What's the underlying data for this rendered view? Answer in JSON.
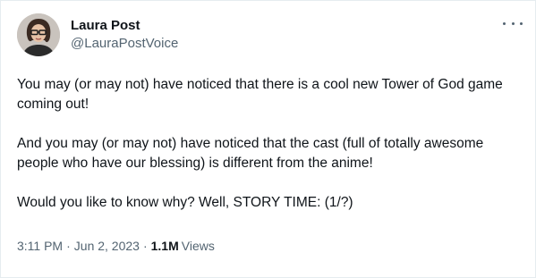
{
  "author": {
    "display_name": "Laura Post",
    "handle": "@LauraPostVoice",
    "avatar_icon": "profile-photo"
  },
  "menu": {
    "icon": "more-options-icon"
  },
  "tweet": {
    "paragraphs": [
      "You may (or may not) have noticed that there is a cool new Tower of God game coming out!",
      "And you may (or may not) have noticed that the cast (full of totally awesome people who have our blessing) is different from the anime!",
      "Would you like to know why? Well, STORY TIME: (1/?)"
    ]
  },
  "meta": {
    "time": "3:11 PM",
    "separator": "·",
    "date": "Jun 2, 2023",
    "views_count": "1.1M",
    "views_label": "Views"
  },
  "colors": {
    "text": "#0f1419",
    "secondary": "#536471",
    "border": "#e6ecf0"
  }
}
